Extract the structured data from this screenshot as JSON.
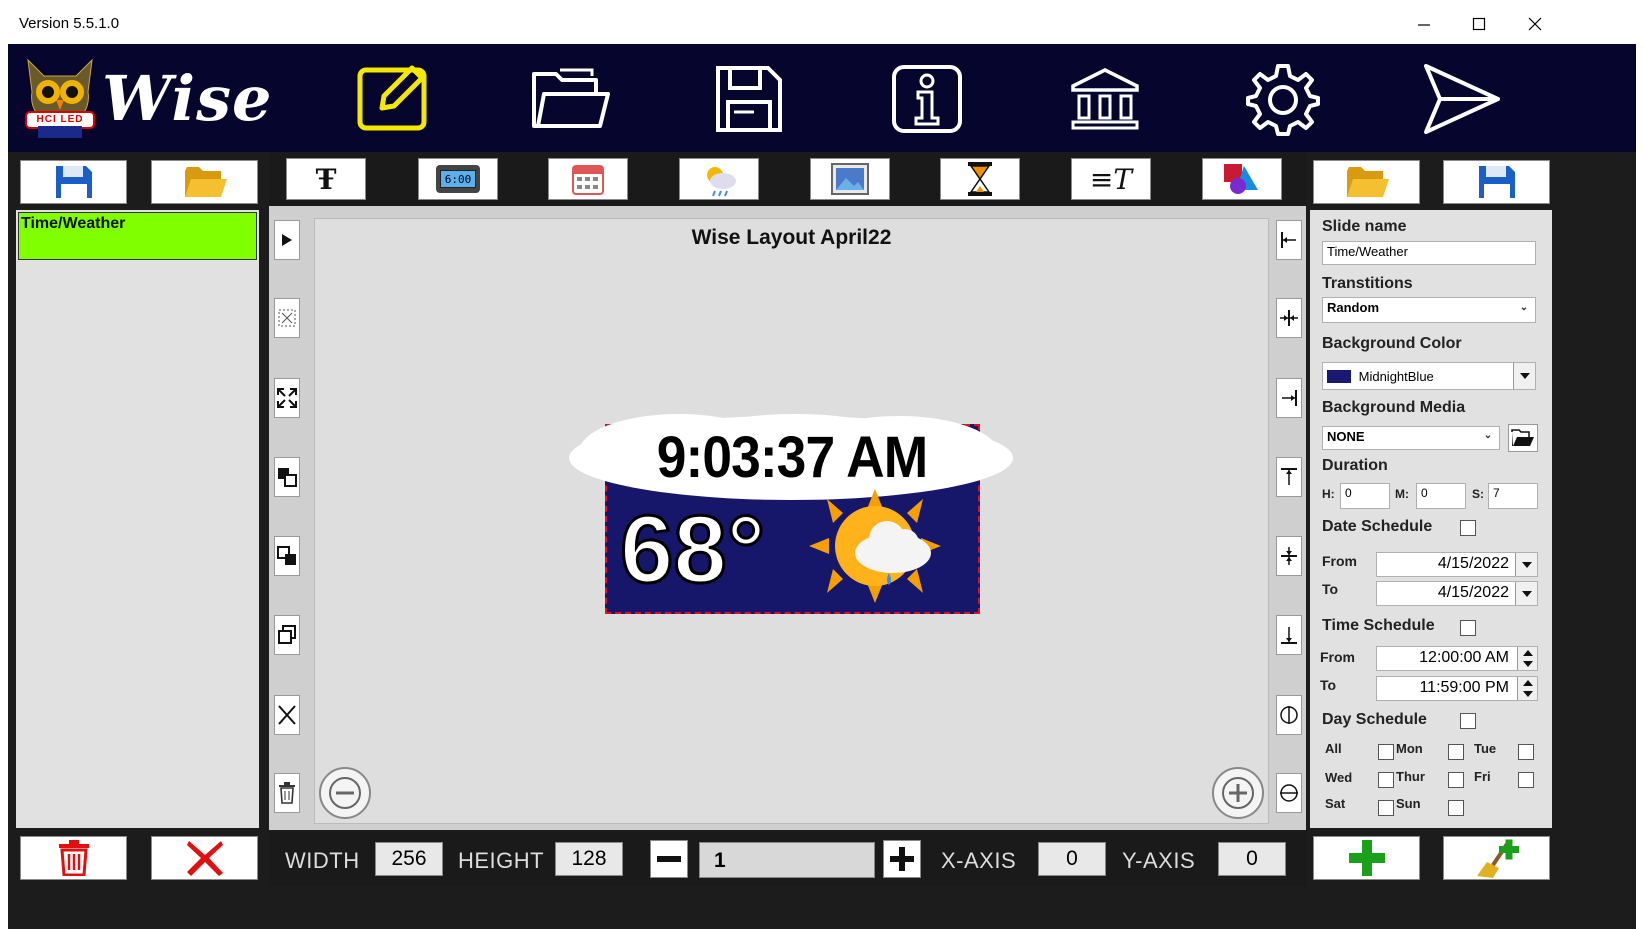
{
  "window": {
    "title": "Version 5.5.1.0",
    "min_icon": "minimize-icon",
    "max_icon": "maximize-icon",
    "close_icon": "close-icon"
  },
  "header": {
    "logo_text": "Wise",
    "logo_badge": "HCI LED",
    "buttons": [
      {
        "name": "edit",
        "icon": "edit-icon",
        "color": "#f5e800"
      },
      {
        "name": "open",
        "icon": "folder-icon",
        "color": "#ffffff"
      },
      {
        "name": "save",
        "icon": "floppy-icon",
        "color": "#ffffff"
      },
      {
        "name": "info",
        "icon": "info-icon",
        "color": "#ffffff"
      },
      {
        "name": "library",
        "icon": "bank-icon",
        "color": "#ffffff"
      },
      {
        "name": "settings",
        "icon": "gear-icon",
        "color": "#ffffff"
      },
      {
        "name": "send",
        "icon": "send-icon",
        "color": "#ffffff"
      }
    ]
  },
  "left_panel": {
    "slides": [
      {
        "label": "Time/Weather",
        "selected": true,
        "color": "#7fff00"
      }
    ]
  },
  "toolbar": {
    "tools": [
      "text-tool",
      "clock-tool",
      "calendar-tool",
      "weather-tool",
      "image-tool",
      "timer-tool",
      "scroll-text-tool",
      "shapes-tool"
    ],
    "clock_display": "6:00"
  },
  "canvas": {
    "title": "Wise Layout April22",
    "time_text": "9:03:37 AM",
    "temperature": "68°",
    "layout_bg": "#16166a"
  },
  "properties": {
    "slide_name_label": "Slide name",
    "slide_name_value": "Time/Weather",
    "transitions_label": "Transtitions",
    "transitions_value": "Random",
    "bg_color_label": "Background Color",
    "bg_color_value": "MidnightBlue",
    "bg_color_swatch": "#191970",
    "bg_media_label": "Background Media",
    "bg_media_value": "NONE",
    "duration_label": "Duration",
    "h_label": "H:",
    "h_value": "0",
    "m_label": "M:",
    "m_value": "0",
    "s_label": "S:",
    "s_value": "7",
    "date_schedule_label": "Date Schedule",
    "date_from_label": "From",
    "date_from_value": "4/15/2022",
    "date_to_label": "To",
    "date_to_value": "4/15/2022",
    "time_schedule_label": "Time Schedule",
    "time_from_label": "From",
    "time_from_value": "12:00:00 AM",
    "time_to_label": "To",
    "time_to_value": "11:59:00 PM",
    "day_schedule_label": "Day Schedule",
    "days": [
      "All",
      "Mon",
      "Tue",
      "Wed",
      "Thur",
      "Fri",
      "Sat",
      "Sun"
    ]
  },
  "bottom": {
    "width_label": "WIDTH",
    "width_value": "256",
    "height_label": "HEIGHT",
    "height_value": "128",
    "zoom_value": "1",
    "x_label": "X-AXIS",
    "x_value": "0",
    "y_label": "Y-AXIS",
    "y_value": "0"
  }
}
